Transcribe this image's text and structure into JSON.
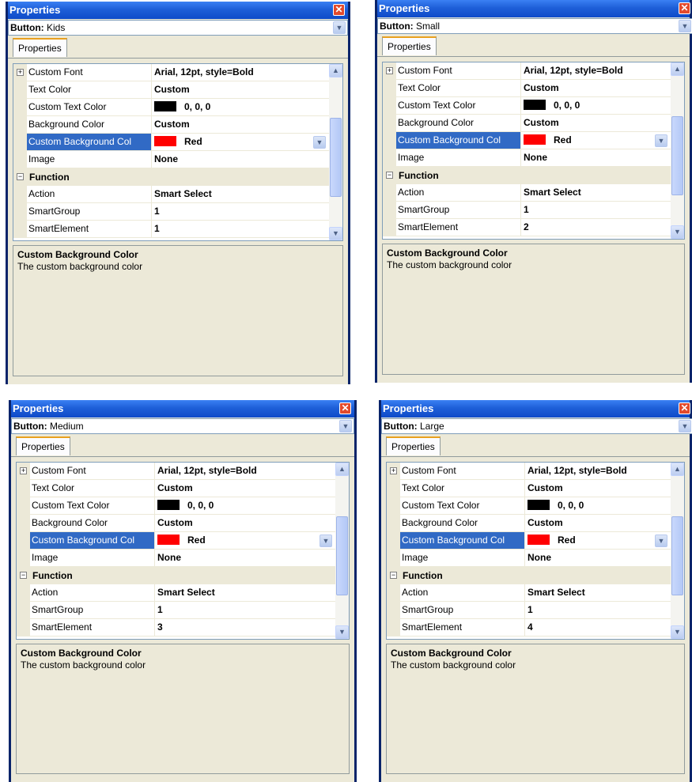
{
  "panels": [
    {
      "title": "Properties",
      "object_label": "Button:",
      "object_name": "Kids",
      "tab": "Properties",
      "rows": {
        "custom_font": {
          "name": "Custom Font",
          "value": "Arial, 12pt, style=Bold"
        },
        "text_color": {
          "name": "Text Color",
          "value": "Custom"
        },
        "custom_text_color": {
          "name": "Custom Text Color",
          "value": "0, 0, 0",
          "swatch": "#000000"
        },
        "background_color": {
          "name": "Background Color",
          "value": "Custom"
        },
        "custom_bg_color": {
          "name": "Custom Background Col",
          "value": "Red",
          "swatch": "#ff0000"
        },
        "image": {
          "name": "Image",
          "value": "None"
        },
        "function_category": "Function",
        "action": {
          "name": "Action",
          "value": "Smart Select"
        },
        "smart_group": {
          "name": "SmartGroup",
          "value": "1"
        },
        "smart_element": {
          "name": "SmartElement",
          "value": "1"
        }
      },
      "description": {
        "title": "Custom Background Color",
        "text": "The custom background color"
      }
    },
    {
      "title": "Properties",
      "object_label": "Button:",
      "object_name": "Small",
      "tab": "Properties",
      "rows": {
        "custom_font": {
          "name": "Custom Font",
          "value": "Arial, 12pt, style=Bold"
        },
        "text_color": {
          "name": "Text Color",
          "value": "Custom"
        },
        "custom_text_color": {
          "name": "Custom Text Color",
          "value": "0, 0, 0",
          "swatch": "#000000"
        },
        "background_color": {
          "name": "Background Color",
          "value": "Custom"
        },
        "custom_bg_color": {
          "name": "Custom Background Col",
          "value": "Red",
          "swatch": "#ff0000"
        },
        "image": {
          "name": "Image",
          "value": "None"
        },
        "function_category": "Function",
        "action": {
          "name": "Action",
          "value": "Smart Select"
        },
        "smart_group": {
          "name": "SmartGroup",
          "value": "1"
        },
        "smart_element": {
          "name": "SmartElement",
          "value": "2"
        }
      },
      "description": {
        "title": "Custom Background Color",
        "text": "The custom background color"
      }
    },
    {
      "title": "Properties",
      "object_label": "Button:",
      "object_name": "Medium",
      "tab": "Properties",
      "rows": {
        "custom_font": {
          "name": "Custom Font",
          "value": "Arial, 12pt, style=Bold"
        },
        "text_color": {
          "name": "Text Color",
          "value": "Custom"
        },
        "custom_text_color": {
          "name": "Custom Text Color",
          "value": "0, 0, 0",
          "swatch": "#000000"
        },
        "background_color": {
          "name": "Background Color",
          "value": "Custom"
        },
        "custom_bg_color": {
          "name": "Custom Background Col",
          "value": "Red",
          "swatch": "#ff0000"
        },
        "image": {
          "name": "Image",
          "value": "None"
        },
        "function_category": "Function",
        "action": {
          "name": "Action",
          "value": "Smart Select"
        },
        "smart_group": {
          "name": "SmartGroup",
          "value": "1"
        },
        "smart_element": {
          "name": "SmartElement",
          "value": "3"
        }
      },
      "description": {
        "title": "Custom Background Color",
        "text": "The custom background color"
      }
    },
    {
      "title": "Properties",
      "object_label": "Button:",
      "object_name": "Large",
      "tab": "Properties",
      "rows": {
        "custom_font": {
          "name": "Custom Font",
          "value": "Arial, 12pt, style=Bold"
        },
        "text_color": {
          "name": "Text Color",
          "value": "Custom"
        },
        "custom_text_color": {
          "name": "Custom Text Color",
          "value": "0, 0, 0",
          "swatch": "#000000"
        },
        "background_color": {
          "name": "Background Color",
          "value": "Custom"
        },
        "custom_bg_color": {
          "name": "Custom Background Col",
          "value": "Red",
          "swatch": "#ff0000"
        },
        "image": {
          "name": "Image",
          "value": "None"
        },
        "function_category": "Function",
        "action": {
          "name": "Action",
          "value": "Smart Select"
        },
        "smart_group": {
          "name": "SmartGroup",
          "value": "1"
        },
        "smart_element": {
          "name": "SmartElement",
          "value": "4"
        }
      },
      "description": {
        "title": "Custom Background Color",
        "text": "The custom background color"
      }
    }
  ],
  "colors": {
    "selection": "#316ac5",
    "titlebar": "#0e4bc9",
    "window_bg": "#ece9d8",
    "close_button": "#e34a2c"
  }
}
